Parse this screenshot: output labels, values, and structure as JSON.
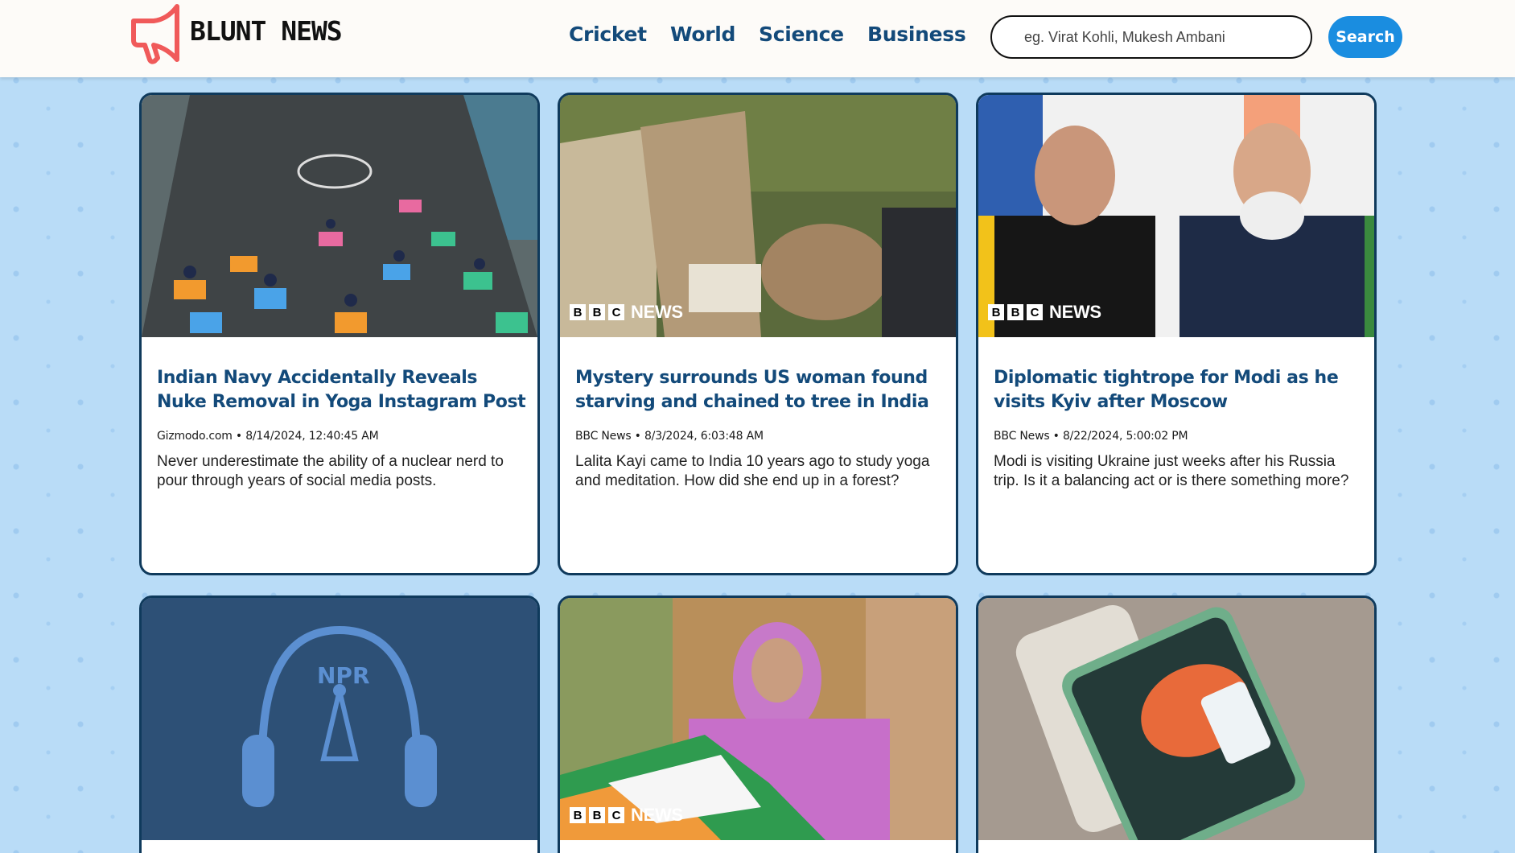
{
  "header": {
    "logo_text": "BLUNT NEWS",
    "nav": [
      "Cricket",
      "World",
      "Science",
      "Business"
    ],
    "search_placeholder": "eg. Virat Kohli, Mukesh Ambani",
    "search_label": "Search"
  },
  "cards": [
    {
      "title": "Indian Navy Accidentally Reveals Nuke Removal in Yoga Instagram Post",
      "meta": "Gizmodo.com • 8/14/2024, 12:40:45 AM",
      "desc": "Never underestimate the ability of a nuclear nerd to pour through years of social media posts."
    },
    {
      "title": "Mystery surrounds US woman found starving and chained to tree in India",
      "meta": "BBC News • 8/3/2024, 6:03:48 AM",
      "desc": "Lalita Kayi came to India 10 years ago to study yoga and meditation. How did she end up in a forest?",
      "watermark": "NEWS"
    },
    {
      "title": "Diplomatic tightrope for Modi as he visits Kyiv after Moscow",
      "meta": "BBC News • 8/22/2024, 5:00:02 PM",
      "desc": "Modi is visiting Ukraine just weeks after his Russia trip. Is it a balancing act or is there something more?",
      "watermark": "NEWS"
    },
    {
      "image_label": "NPR"
    },
    {
      "watermark": "NEWS"
    },
    {}
  ],
  "colors": {
    "accent": "#1a8de0",
    "title": "#134a7a",
    "border": "#0f3a5c",
    "background": "#b9dcf7"
  }
}
